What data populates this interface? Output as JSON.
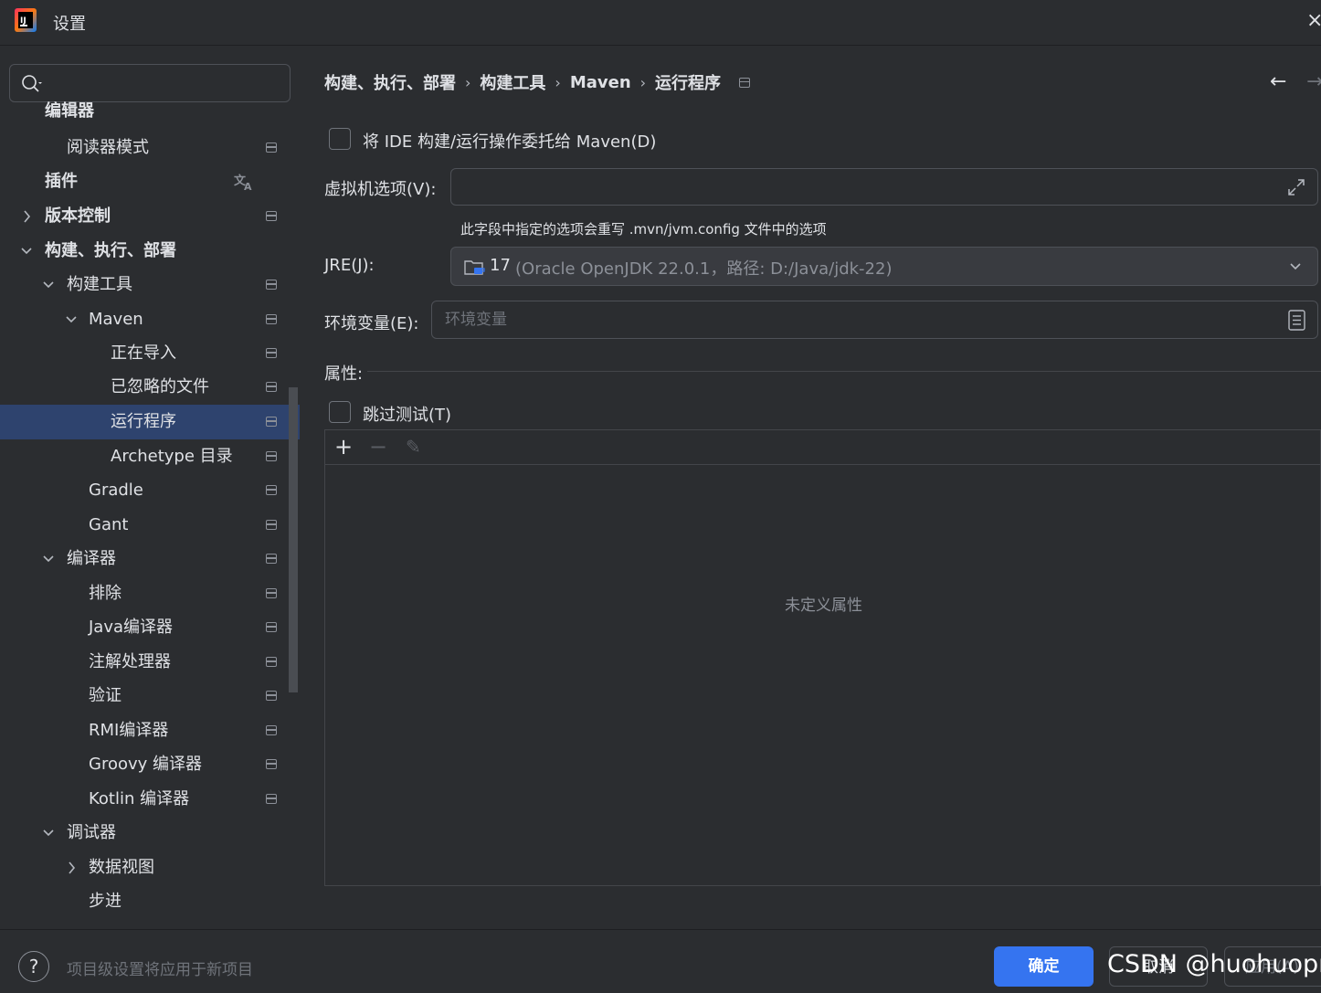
{
  "window": {
    "title": "设置",
    "close_glyph": "×"
  },
  "sidebar": {
    "search": {
      "value": "",
      "placeholder": ""
    },
    "items": [
      {
        "label": "编辑器",
        "bold": true
      },
      {
        "label": "阅读器模式"
      },
      {
        "label": "插件",
        "bold": true
      },
      {
        "label": "版本控制",
        "bold": true,
        "arrow": "›"
      },
      {
        "label": "构建、执行、部署",
        "bold": true,
        "arrow": "⌄"
      },
      {
        "label": "构建工具",
        "arrow": "⌄"
      },
      {
        "label": "Maven",
        "arrow": "⌄"
      },
      {
        "label": "正在导入"
      },
      {
        "label": "已忽略的文件"
      },
      {
        "label": "运行程序",
        "selected": true
      },
      {
        "label": "Archetype 目录"
      },
      {
        "label": "Gradle"
      },
      {
        "label": "Gant"
      },
      {
        "label": "编译器",
        "arrow": "⌄"
      },
      {
        "label": "排除"
      },
      {
        "label": "Java编译器"
      },
      {
        "label": "注解处理器"
      },
      {
        "label": "验证"
      },
      {
        "label": "RMI编译器"
      },
      {
        "label": "Groovy 编译器"
      },
      {
        "label": "Kotlin 编译器"
      },
      {
        "label": "调试器",
        "arrow": "⌄"
      },
      {
        "label": "数据视图",
        "arrow": "›"
      },
      {
        "label": "步进"
      }
    ]
  },
  "breadcrumb": [
    "构建、执行、部署",
    "构建工具",
    "Maven",
    "运行程序"
  ],
  "breadcrumb_sep": "›",
  "nav": {
    "back": "←",
    "forward": "→"
  },
  "form": {
    "delegate_label": "将 IDE 构建/运行操作委托给 Maven(D)",
    "vm_options_label": "虚拟机选项(V):",
    "vm_options_value": "",
    "vm_hint": "此字段中指定的选项会重写 .mvn/jvm.config 文件中的选项",
    "jre_label": "JRE(J):",
    "jre_version": "17",
    "jre_detail": "(Oracle OpenJDK 22.0.1，路径: D:/Java/jdk-22)",
    "env_label": "环境变量(E):",
    "env_placeholder": "环境变量",
    "env_value": "",
    "properties_label": "属性:",
    "skip_tests_label": "跳过测试(T)",
    "properties_empty": "未定义属性",
    "toolbar": {
      "add": "+",
      "remove": "−",
      "edit": "✎"
    }
  },
  "footer": {
    "help": "?",
    "hint": "项目级设置将应用于新项目",
    "ok": "确定",
    "cancel": "取消",
    "apply": "应用(A)"
  },
  "watermark": "CSDN @huohuopro",
  "colors": {
    "background": "#2b2d30",
    "selection": "#2e436e",
    "accent": "#3574f0",
    "text": "#dfe1e5",
    "muted": "#8c9098"
  }
}
